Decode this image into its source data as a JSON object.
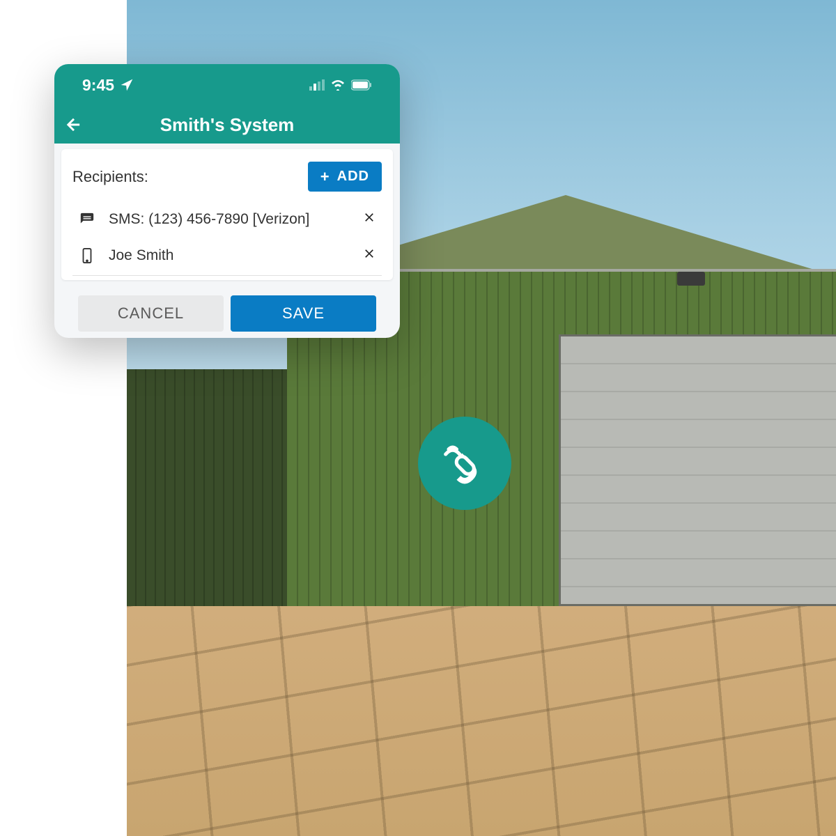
{
  "status_bar": {
    "time": "9:45"
  },
  "header": {
    "title": "Smith's System"
  },
  "recipients": {
    "label": "Recipients:",
    "add_button": "ADD",
    "items": [
      {
        "type": "sms",
        "text": "SMS: (123) 456-7890 [Verizon]"
      },
      {
        "type": "contact",
        "text": "Joe Smith"
      }
    ]
  },
  "buttons": {
    "cancel": "CANCEL",
    "save": "SAVE"
  },
  "colors": {
    "teal": "#179a8c",
    "blue": "#0a7cc4"
  }
}
